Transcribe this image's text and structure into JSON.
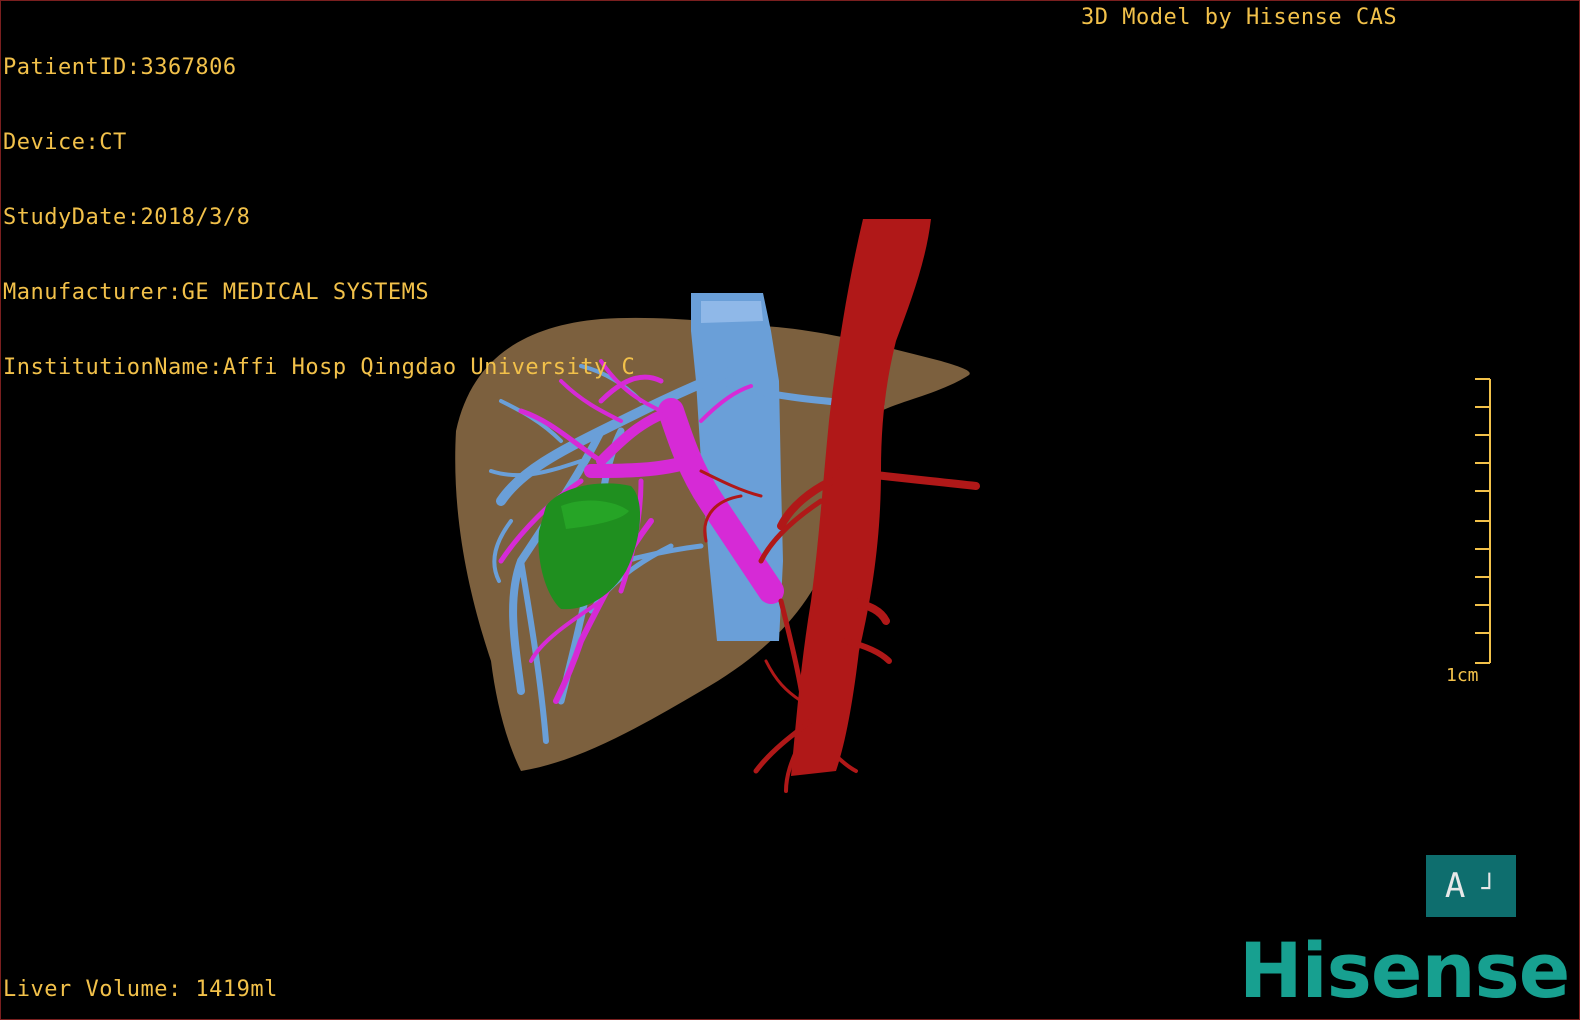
{
  "header": {
    "patient_id": "PatientID:3367806",
    "device": "Device:CT",
    "study_date": "StudyDate:2018/3/8",
    "manufacturer": "Manufacturer:GE MEDICAL SYSTEMS",
    "institution": "InstitutionName:Affi Hosp Qingdao University C"
  },
  "brand_tag": "3D Model by Hisense CAS",
  "scale": {
    "label": "1cm"
  },
  "orientation": {
    "letter": "A",
    "corner_glyph": "┘"
  },
  "footer": {
    "liver_volume": "Liver Volume: 1419ml"
  },
  "logo": {
    "text": "Hisense"
  },
  "colors": {
    "overlay_text": "#f2c14a",
    "liver": "#8a6a45",
    "portal_vein": "#d62ad6",
    "hepatic_vein": "#6a9fd8",
    "artery": "#b01818",
    "lesion": "#1f8f1f",
    "logo": "#17a090",
    "orient_button": "#0e6e6e"
  },
  "icons": [
    "orientation-cube-icon",
    "hisense-logo"
  ]
}
